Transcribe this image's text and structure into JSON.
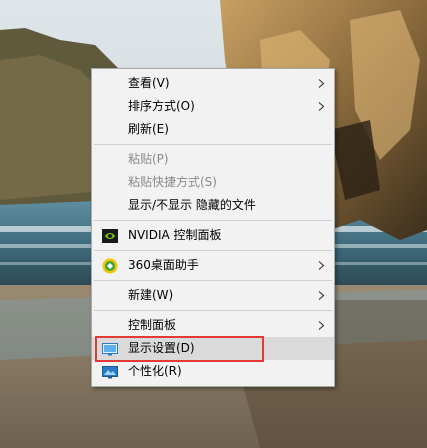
{
  "menu": {
    "items": [
      {
        "label": "查看(V)"
      },
      {
        "label": "排序方式(O)"
      },
      {
        "label": "刷新(E)"
      },
      {
        "label": "粘贴(P)"
      },
      {
        "label": "粘贴快捷方式(S)"
      },
      {
        "label": "显示/不显示 隐藏的文件"
      },
      {
        "label": "NVIDIA 控制面板"
      },
      {
        "label": "360桌面助手"
      },
      {
        "label": "新建(W)"
      },
      {
        "label": "控制面板"
      },
      {
        "label": "显示设置(D)"
      },
      {
        "label": "个性化(R)"
      }
    ]
  },
  "colors": {
    "highlight_border": "#e53935",
    "nvidia_green": "#76b900",
    "assistant_yellow": "#f5c400"
  }
}
